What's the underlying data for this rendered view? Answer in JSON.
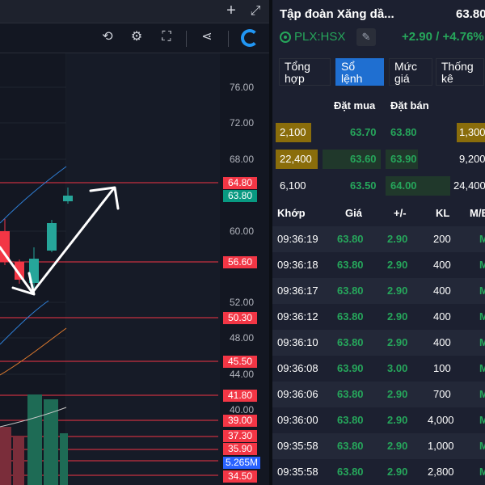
{
  "chart": {
    "price_ticks": [
      "76.00",
      "72.00",
      "68.00",
      "60.00",
      "52.00",
      "48.00",
      "44.00",
      "40.00"
    ],
    "price_labels": [
      {
        "text": "64.80",
        "color": "#f23645"
      },
      {
        "text": "63.80",
        "color": "#089981"
      },
      {
        "text": "56.60",
        "color": "#f23645"
      },
      {
        "text": "50.30",
        "color": "#f23645"
      },
      {
        "text": "45.50",
        "color": "#f23645"
      },
      {
        "text": "41.80",
        "color": "#f23645"
      },
      {
        "text": "39.00",
        "color": "#f23645"
      },
      {
        "text": "37.30",
        "color": "#f23645"
      },
      {
        "text": "35.90",
        "color": "#f23645"
      },
      {
        "text": "5.265M",
        "color": "#2962ff"
      },
      {
        "text": "34.50",
        "color": "#f23645"
      }
    ],
    "candles": [
      {
        "color": "#f23645"
      },
      {
        "color": "#f23645"
      },
      {
        "color": "#f23645"
      },
      {
        "color": "#26a69a"
      },
      {
        "color": "#26a69a"
      },
      {
        "color": "#26a69a"
      }
    ],
    "toolbar_icons": [
      "plus-icon",
      "expand-icon",
      "replay-icon",
      "settings-icon",
      "fullscreen-icon",
      "share-icon",
      "logo-icon"
    ]
  },
  "stock": {
    "company": "Tập đoàn Xăng dầ...",
    "price": "63.80",
    "symbol": "PLX:HSX",
    "change": "+2.90 / +4.76%"
  },
  "tabs": [
    {
      "l1": "Tổng",
      "l2": "hợp"
    },
    {
      "l1": "Sổ",
      "l2": "lệnh"
    },
    {
      "l1": "Mức",
      "l2": "giá"
    },
    {
      "l1": "Thống",
      "l2": "kê"
    }
  ],
  "orderbook": {
    "buy_header": "Đặt mua",
    "sell_header": "Đặt bán",
    "rows": [
      {
        "buy_vol": "2,100",
        "buy_price": "63.70",
        "sell_price": "63.80",
        "sell_vol": "1,300"
      },
      {
        "buy_vol": "22,400",
        "buy_price": "63.60",
        "sell_price": "63.90",
        "sell_vol": "9,200"
      },
      {
        "buy_vol": "6,100",
        "buy_price": "63.50",
        "sell_price": "64.00",
        "sell_vol": "24,400"
      }
    ]
  },
  "trades": {
    "headers": {
      "time": "Khớp",
      "price": "Giá",
      "change": "+/-",
      "vol": "KL",
      "side": "M/B"
    },
    "rows": [
      {
        "time": "09:36:19",
        "price": "63.80",
        "change": "2.90",
        "vol": "200",
        "side": "M"
      },
      {
        "time": "09:36:18",
        "price": "63.80",
        "change": "2.90",
        "vol": "400",
        "side": "M"
      },
      {
        "time": "09:36:17",
        "price": "63.80",
        "change": "2.90",
        "vol": "400",
        "side": "M"
      },
      {
        "time": "09:36:12",
        "price": "63.80",
        "change": "2.90",
        "vol": "400",
        "side": "M"
      },
      {
        "time": "09:36:10",
        "price": "63.80",
        "change": "2.90",
        "vol": "400",
        "side": "M"
      },
      {
        "time": "09:36:08",
        "price": "63.90",
        "change": "3.00",
        "vol": "100",
        "side": "M"
      },
      {
        "time": "09:36:06",
        "price": "63.80",
        "change": "2.90",
        "vol": "700",
        "side": "M"
      },
      {
        "time": "09:36:00",
        "price": "63.80",
        "change": "2.90",
        "vol": "4,000",
        "side": "M"
      },
      {
        "time": "09:35:58",
        "price": "63.80",
        "change": "2.90",
        "vol": "1,000",
        "side": "M"
      },
      {
        "time": "09:35:58",
        "price": "63.80",
        "change": "2.90",
        "vol": "2,800",
        "side": "M"
      }
    ]
  },
  "colors": {
    "up": "#26a65b",
    "down": "#f23645",
    "highlight_buy": "#8a6d0b",
    "highlight_sell": "#8a6d0b",
    "active_tab": "#1f6fd1"
  }
}
